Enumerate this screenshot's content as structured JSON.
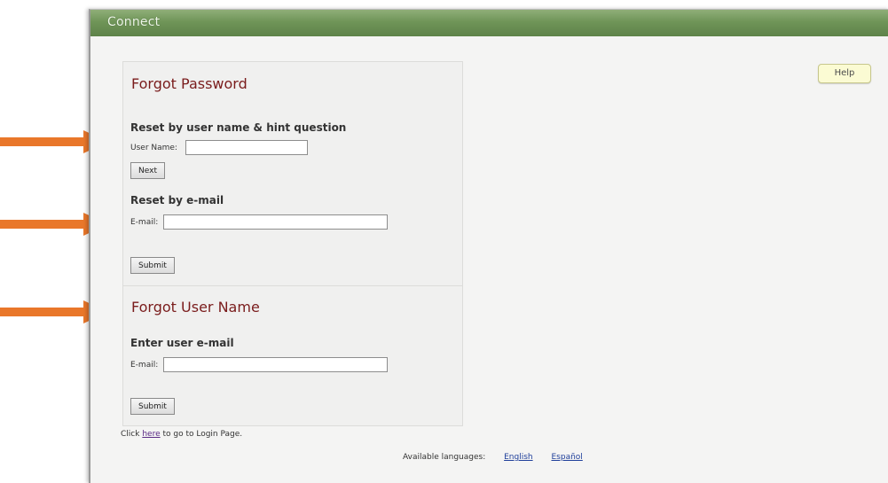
{
  "app": {
    "title": "Connect"
  },
  "toolbar": {
    "help_label": "Help"
  },
  "forgot_password": {
    "heading": "Forgot Password",
    "by_username": {
      "title": "Reset by user name & hint question",
      "username_label": "User Name:",
      "username_value": "",
      "next_label": "Next"
    },
    "by_email": {
      "title": "Reset by e-mail",
      "email_label": "E-mail:",
      "email_value": "",
      "submit_label": "Submit"
    }
  },
  "forgot_username": {
    "heading": "Forgot User Name",
    "title": "Enter user e-mail",
    "email_label": "E-mail:",
    "email_value": "",
    "submit_label": "Submit"
  },
  "footer": {
    "click_prefix": "Click",
    "here_link": "here",
    "click_suffix": "to go to Login Page.",
    "languages_label": "Available languages:",
    "languages": [
      "English",
      "Español"
    ]
  },
  "colors": {
    "titlebar": "#6f9558",
    "heading": "#7a1c1c",
    "arrow": "#e9772a",
    "help_button": "#fbfbd3"
  }
}
